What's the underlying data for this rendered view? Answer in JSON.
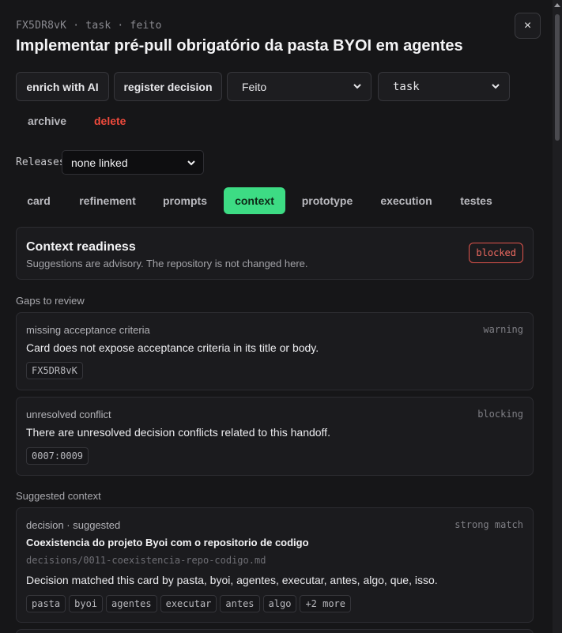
{
  "header": {
    "meta": "FX5DR8vK · task · feito",
    "title": "Implementar pré-pull obrigatório da pasta BYOI em agentes",
    "close_label": "×"
  },
  "actions": {
    "enrich_label": "enrich with AI",
    "register_label": "register decision",
    "status_value": "Feito",
    "type_value": "task",
    "archive_label": "archive",
    "delete_label": "delete"
  },
  "releases": {
    "label": "Releases",
    "value": "none linked"
  },
  "tabs": [
    {
      "label": "card"
    },
    {
      "label": "refinement"
    },
    {
      "label": "prompts"
    },
    {
      "label": "context"
    },
    {
      "label": "prototype"
    },
    {
      "label": "execution"
    },
    {
      "label": "testes"
    }
  ],
  "readiness": {
    "title": "Context readiness",
    "subtitle": "Suggestions are advisory. The repository is not changed here.",
    "status": "blocked"
  },
  "gaps": {
    "label": "Gaps to review",
    "items": [
      {
        "type": "missing acceptance criteria",
        "severity": "warning",
        "description": "Card does not expose acceptance criteria in its title or body.",
        "ref": "FX5DR8vK"
      },
      {
        "type": "unresolved conflict",
        "severity": "blocking",
        "description": "There are unresolved decision conflicts related to this handoff.",
        "ref": "0007:0009"
      }
    ]
  },
  "suggested": {
    "label": "Suggested context",
    "items": [
      {
        "kind": "decision · suggested",
        "match": "strong match",
        "title": "Coexistencia do projeto Byoi com o repositorio de codigo",
        "path": "decisions/0011-coexistencia-repo-codigo.md",
        "description": "Decision matched this card by pasta, byoi, agentes, executar, antes, algo, que, isso.",
        "chips": [
          "pasta",
          "byoi",
          "agentes",
          "executar",
          "antes",
          "algo",
          "+2 more"
        ]
      }
    ]
  },
  "colors": {
    "accent": "#3ddc84",
    "danger": "#ef4a3c",
    "background": "#161618"
  }
}
